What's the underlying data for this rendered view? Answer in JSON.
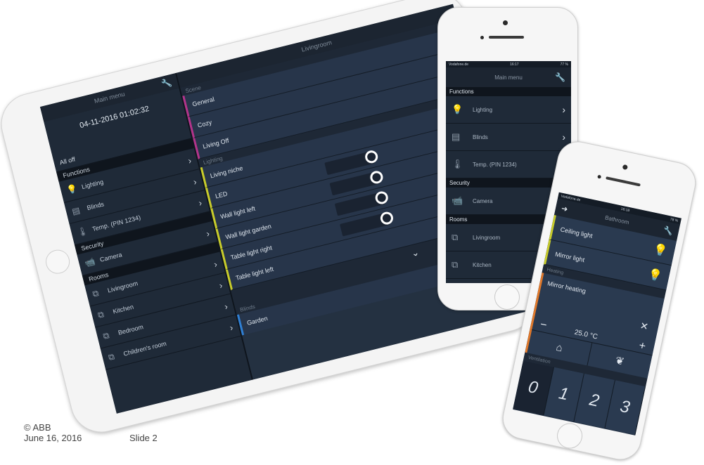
{
  "ipad": {
    "left_panel": {
      "title": "Main menu",
      "datetime": "04-11-2016 01:02:32",
      "all_off": "All off",
      "functions_header": "Functions",
      "functions": [
        {
          "icon": "lighting-icon",
          "label": "Lighting"
        },
        {
          "icon": "blinds-icon",
          "label": "Blinds"
        },
        {
          "icon": "thermometer-icon",
          "label": "Temp. (PIN 1234)"
        }
      ],
      "security_header": "Security",
      "security": [
        {
          "icon": "camera-icon",
          "label": "Camera"
        }
      ],
      "rooms_header": "Rooms",
      "rooms": [
        {
          "icon": "room-icon",
          "label": "Livingroom"
        },
        {
          "icon": "room-icon",
          "label": "Kitchen"
        },
        {
          "icon": "room-icon",
          "label": "Bedroom"
        },
        {
          "icon": "room-icon",
          "label": "Children's room"
        }
      ]
    },
    "right_panel": {
      "title": "Livingroom",
      "scene_header": "Scene",
      "scenes": [
        "General",
        "Cozy",
        "Living Off"
      ],
      "lighting_header": "Lighting",
      "lights": [
        "Living niche",
        "LED",
        "Wall light left",
        "Wall light garden",
        "Table light right",
        "Table light left"
      ],
      "blinds_header": "Blinds",
      "blinds": [
        "Garden"
      ]
    }
  },
  "phone1": {
    "status": {
      "carrier": "Vodafone.de",
      "time": "16:17",
      "battery": "77 %"
    },
    "title": "Main menu",
    "functions_header": "Functions",
    "functions": [
      {
        "icon": "lighting-icon",
        "label": "Lighting"
      },
      {
        "icon": "blinds-icon",
        "label": "Blinds"
      },
      {
        "icon": "thermometer-icon",
        "label": "Temp. (PIN 1234)"
      }
    ],
    "security_header": "Security",
    "security": [
      {
        "icon": "camera-icon",
        "label": "Camera"
      }
    ],
    "rooms_header": "Rooms",
    "rooms": [
      {
        "icon": "room-icon",
        "label": "Livingroom"
      },
      {
        "icon": "room-icon",
        "label": "Kitchen"
      }
    ]
  },
  "phone2": {
    "status": {
      "carrier": "Vodafone.de",
      "time": "16:18",
      "battery": "78 %"
    },
    "title": "Bathroom",
    "lights": [
      "Ceiling light",
      "Mirror light"
    ],
    "heating_header": "Heating",
    "heating": {
      "name": "Mirror heating",
      "temperature": "25.0 °C"
    },
    "ventilation_header": "Ventilation",
    "ventilation_levels": [
      "0",
      "1",
      "2",
      "3"
    ],
    "ventilation_active": "0"
  },
  "footer": {
    "copyright": "© ABB",
    "date": "June 16, 2016",
    "slide": "Slide 2"
  }
}
